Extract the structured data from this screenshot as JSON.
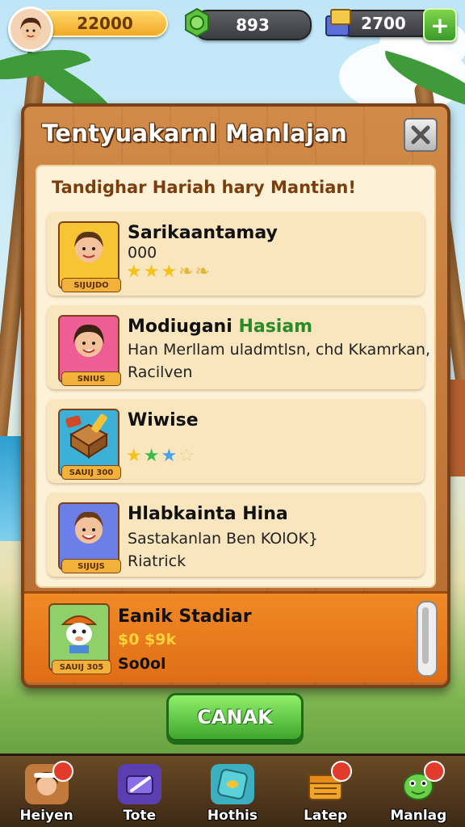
{
  "hud": {
    "coins": "22000",
    "gems": "893",
    "cards": "2700",
    "add_label": "+"
  },
  "modal": {
    "title": "Tentyuakarnl Manlajan",
    "subtitle": "Tandighar Hariah hary Mantian!",
    "close_icon": "close-icon",
    "items": [
      {
        "name": "Sarikaantamay",
        "line1": "000",
        "line2": "",
        "tag": "SIJUJDO",
        "stars": "3 gold, 2 leaf"
      },
      {
        "name": "Modiugani",
        "name_accent": "Hasiam",
        "line1": "Han Merllam uladmtlsn, chd Kkamrkan,",
        "line2": "Racilven",
        "tag": "SNIUS"
      },
      {
        "name": "Wiwise",
        "line1": "",
        "line2": "",
        "tag": "SAUIJ 300",
        "stars": "gold, green, blue, outline"
      },
      {
        "name": "Hlabkainta Hina",
        "line1": "Sastakanlan Ben KOlOK}",
        "line2": "Riatrick",
        "tag": "SIJUJS"
      }
    ],
    "footer_item": {
      "name": "Eanik Stadiar",
      "price": "$0 $9k",
      "line2": "So0ol",
      "tag": "SAUIJ 305"
    },
    "ok_label": "CANAK"
  },
  "nav": [
    {
      "label": "Heiyen",
      "icon": "avatar-icon"
    },
    {
      "label": "Tote",
      "icon": "wallet-icon"
    },
    {
      "label": "Hothis",
      "icon": "map-icon"
    },
    {
      "label": "Latep",
      "icon": "chest-icon"
    },
    {
      "label": "Manlag",
      "icon": "monster-icon"
    }
  ],
  "colors": {
    "wood": "#c27a3c",
    "panel": "#fdf2d8",
    "accent_green": "#3fa62c",
    "footer_orange": "#f08a25"
  }
}
